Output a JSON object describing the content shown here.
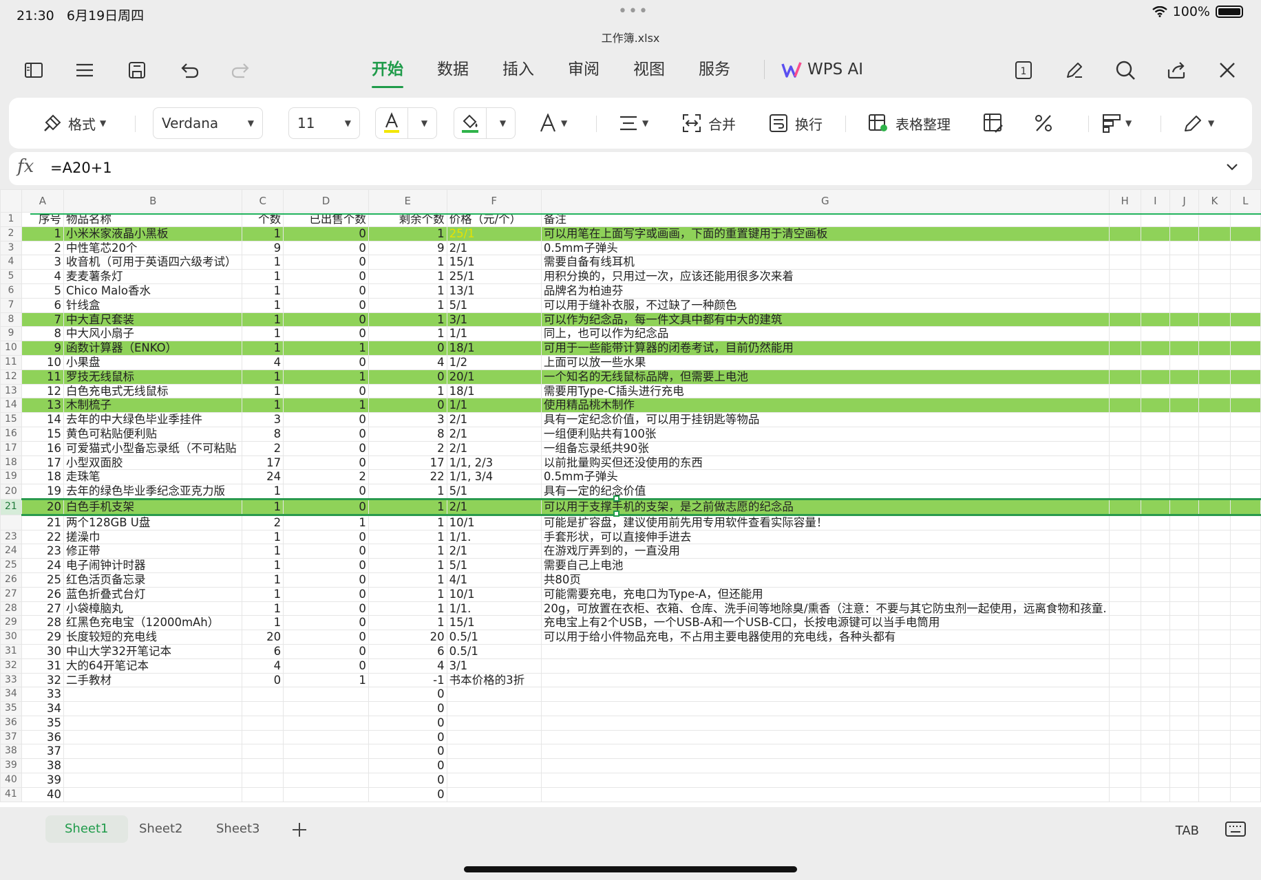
{
  "status": {
    "time": "21:30",
    "date": "6月19日周四",
    "battery": "100%"
  },
  "file_title": "工作簿.xlsx",
  "tabs": [
    "开始",
    "数据",
    "插入",
    "审阅",
    "视图",
    "服务"
  ],
  "wps_ai": "WPS AI",
  "ribbon": {
    "format": "格式",
    "font": "Verdana",
    "size": "11",
    "merge": "合并",
    "wrap": "换行",
    "table_tidy": "表格整理"
  },
  "formula": "=A20+1",
  "columns": [
    "A",
    "B",
    "C",
    "D",
    "E",
    "F",
    "G",
    "H",
    "I",
    "J",
    "K",
    "L"
  ],
  "rows": [
    {
      "n": "1",
      "a": "序号",
      "b": "物品名称",
      "c": "个数",
      "d": "已出售个数",
      "e": "剩余个数",
      "f": "价格（元/个）",
      "g": "备注"
    },
    {
      "n": "2",
      "a": "1",
      "b": "小米米家液晶小黑板",
      "c": "1",
      "d": "0",
      "e": "1",
      "f": "25/1",
      "g": "可以用笔在上面写字或画画，下面的重置键用于清空画板",
      "hl": true,
      "fy": true
    },
    {
      "n": "3",
      "a": "2",
      "b": "中性笔芯20个",
      "c": "9",
      "d": "0",
      "e": "9",
      "f": "2/1",
      "g": "0.5mm子弹头"
    },
    {
      "n": "4",
      "a": "3",
      "b": "收音机（可用于英语四六级考试）",
      "c": "1",
      "d": "0",
      "e": "1",
      "f": "15/1",
      "g": "需要自备有线耳机"
    },
    {
      "n": "5",
      "a": "4",
      "b": "麦麦薯条灯",
      "c": "1",
      "d": "0",
      "e": "1",
      "f": "25/1",
      "g": "用积分换的，只用过一次，应该还能用很多次来着"
    },
    {
      "n": "6",
      "a": "5",
      "b": "Chico Malo香水",
      "c": "1",
      "d": "0",
      "e": "1",
      "f": "13/1",
      "g": "品牌名为柏迪芬"
    },
    {
      "n": "7",
      "a": "6",
      "b": "针线盒",
      "c": "1",
      "d": "0",
      "e": "1",
      "f": "5/1",
      "g": "可以用于缝补衣服，不过缺了一种颜色"
    },
    {
      "n": "8",
      "a": "7",
      "b": "中大直尺套装",
      "c": "1",
      "d": "0",
      "e": "1",
      "f": "3/1",
      "g": "可以作为纪念品，每一件文具中都有中大的建筑",
      "hl": true
    },
    {
      "n": "9",
      "a": "8",
      "b": "中大风小扇子",
      "c": "1",
      "d": "0",
      "e": "1",
      "f": "1/1",
      "g": "同上，也可以作为纪念品"
    },
    {
      "n": "10",
      "a": "9",
      "b": "函数计算器（ENKO）",
      "c": "1",
      "d": "1",
      "e": "0",
      "f": "18/1",
      "g": "可用于一些能带计算器的闭卷考试，目前仍然能用",
      "hl": true
    },
    {
      "n": "11",
      "a": "10",
      "b": "小果盘",
      "c": "4",
      "d": "0",
      "e": "4",
      "f": "1/2",
      "g": "上面可以放一些水果"
    },
    {
      "n": "12",
      "a": "11",
      "b": "罗技无线鼠标",
      "c": "1",
      "d": "1",
      "e": "0",
      "f": "20/1",
      "g": "一个知名的无线鼠标品牌，但需要上电池",
      "hl": true
    },
    {
      "n": "13",
      "a": "12",
      "b": "白色充电式无线鼠标",
      "c": "1",
      "d": "0",
      "e": "1",
      "f": "18/1",
      "g": "需要用Type-C插头进行充电"
    },
    {
      "n": "14",
      "a": "13",
      "b": "木制梳子",
      "c": "1",
      "d": "1",
      "e": "0",
      "f": "1/1",
      "g": "使用精品桃木制作",
      "hl": true
    },
    {
      "n": "15",
      "a": "14",
      "b": "去年的中大绿色毕业季挂件",
      "c": "3",
      "d": "0",
      "e": "3",
      "f": "2/1",
      "g": "具有一定纪念价值，可以用于挂钥匙等物品"
    },
    {
      "n": "16",
      "a": "15",
      "b": "黄色可粘贴便利贴",
      "c": "8",
      "d": "0",
      "e": "8",
      "f": "2/1",
      "g": "一组便利贴共有100张"
    },
    {
      "n": "17",
      "a": "16",
      "b": "可爱猫式小型备忘录纸（不可粘贴",
      "c": "2",
      "d": "0",
      "e": "2",
      "f": "2/1",
      "g": "一组备忘录纸共90张"
    },
    {
      "n": "18",
      "a": "17",
      "b": "小型双面胶",
      "c": "17",
      "d": "0",
      "e": "17",
      "f": "1/1, 2/3",
      "g": "以前批量购买但还没使用的东西"
    },
    {
      "n": "19",
      "a": "18",
      "b": "走珠笔",
      "c": "24",
      "d": "2",
      "e": "22",
      "f": "1/1, 3/4",
      "g": "0.5mm子弹头"
    },
    {
      "n": "20",
      "a": "19",
      "b": "去年的绿色毕业季纪念亚克力版",
      "c": "1",
      "d": "0",
      "e": "1",
      "f": "5/1",
      "g": "具有一定的纪念价值"
    },
    {
      "n": "21",
      "a": "20",
      "b": "白色手机支架",
      "c": "1",
      "d": "0",
      "e": "1",
      "f": "2/1",
      "g": "可以用于支撑手机的支架，是之前做志愿的纪念品",
      "sel": true
    },
    {
      "n": "",
      "a": "21",
      "b": "两个128GB U盘",
      "c": "2",
      "d": "1",
      "e": "1",
      "f": "10/1",
      "g": "可能是扩容盘，建议使用前先用专用软件查看实际容量！"
    },
    {
      "n": "23",
      "a": "22",
      "b": "搓澡巾",
      "c": "1",
      "d": "0",
      "e": "1",
      "f": "1/1.",
      "g": "手套形状，可以直接伸手进去"
    },
    {
      "n": "24",
      "a": "23",
      "b": "修正带",
      "c": "1",
      "d": "0",
      "e": "1",
      "f": "2/1",
      "g": "在游戏厅弄到的，一直没用"
    },
    {
      "n": "25",
      "a": "24",
      "b": "电子闹钟计时器",
      "c": "1",
      "d": "0",
      "e": "1",
      "f": "5/1",
      "g": "需要自己上电池"
    },
    {
      "n": "26",
      "a": "25",
      "b": "红色活页备忘录",
      "c": "1",
      "d": "0",
      "e": "1",
      "f": "4/1",
      "g": "共80页"
    },
    {
      "n": "27",
      "a": "26",
      "b": "蓝色折叠式台灯",
      "c": "1",
      "d": "0",
      "e": "1",
      "f": "10/1",
      "g": "可能需要充电，充电口为Type-A，但还能用"
    },
    {
      "n": "28",
      "a": "27",
      "b": "小袋樟脑丸",
      "c": "1",
      "d": "0",
      "e": "1",
      "f": "1/1.",
      "g": "20g，可放置在衣柜、衣箱、仓库、洗手间等地除臭/熏香（注意：不要与其它防虫剂一起使用，远离食物和孩童."
    },
    {
      "n": "29",
      "a": "28",
      "b": "红黑色充电宝（12000mAh）",
      "c": "1",
      "d": "0",
      "e": "1",
      "f": "15/1",
      "g": "充电宝上有2个USB，一个USB-A和一个USB-C口，长按电源键可以当手电筒用"
    },
    {
      "n": "30",
      "a": "29",
      "b": "长度较短的充电线",
      "c": "20",
      "d": "0",
      "e": "20",
      "f": "0.5/1",
      "g": "可以用于给小件物品充电，不占用主要电器使用的充电线，各种头都有"
    },
    {
      "n": "31",
      "a": "30",
      "b": "中山大学32开笔记本",
      "c": "6",
      "d": "0",
      "e": "6",
      "f": "0.5/1",
      "g": ""
    },
    {
      "n": "32",
      "a": "31",
      "b": "大的64开笔记本",
      "c": "4",
      "d": "0",
      "e": "4",
      "f": "3/1",
      "g": ""
    },
    {
      "n": "33",
      "a": "32",
      "b": "二手教材",
      "c": "0",
      "d": "1",
      "e": "-1",
      "f": "书本价格的3折",
      "g": ""
    },
    {
      "n": "34",
      "a": "33",
      "b": "",
      "c": "",
      "d": "",
      "e": "0",
      "f": "",
      "g": ""
    },
    {
      "n": "35",
      "a": "34",
      "b": "",
      "c": "",
      "d": "",
      "e": "0",
      "f": "",
      "g": ""
    },
    {
      "n": "36",
      "a": "35",
      "b": "",
      "c": "",
      "d": "",
      "e": "0",
      "f": "",
      "g": ""
    },
    {
      "n": "37",
      "a": "36",
      "b": "",
      "c": "",
      "d": "",
      "e": "0",
      "f": "",
      "g": ""
    },
    {
      "n": "38",
      "a": "37",
      "b": "",
      "c": "",
      "d": "",
      "e": "0",
      "f": "",
      "g": ""
    },
    {
      "n": "39",
      "a": "38",
      "b": "",
      "c": "",
      "d": "",
      "e": "0",
      "f": "",
      "g": ""
    },
    {
      "n": "40",
      "a": "39",
      "b": "",
      "c": "",
      "d": "",
      "e": "0",
      "f": "",
      "g": ""
    },
    {
      "n": "41",
      "a": "40",
      "b": "",
      "c": "",
      "d": "",
      "e": "0",
      "f": "",
      "g": ""
    }
  ],
  "sheets": [
    "Sheet1",
    "Sheet2",
    "Sheet3"
  ],
  "tab_key": "TAB",
  "colors": {
    "accent": "#1f9b4a",
    "highlight": "#8fd259",
    "yellow_text": "#e6e200"
  }
}
